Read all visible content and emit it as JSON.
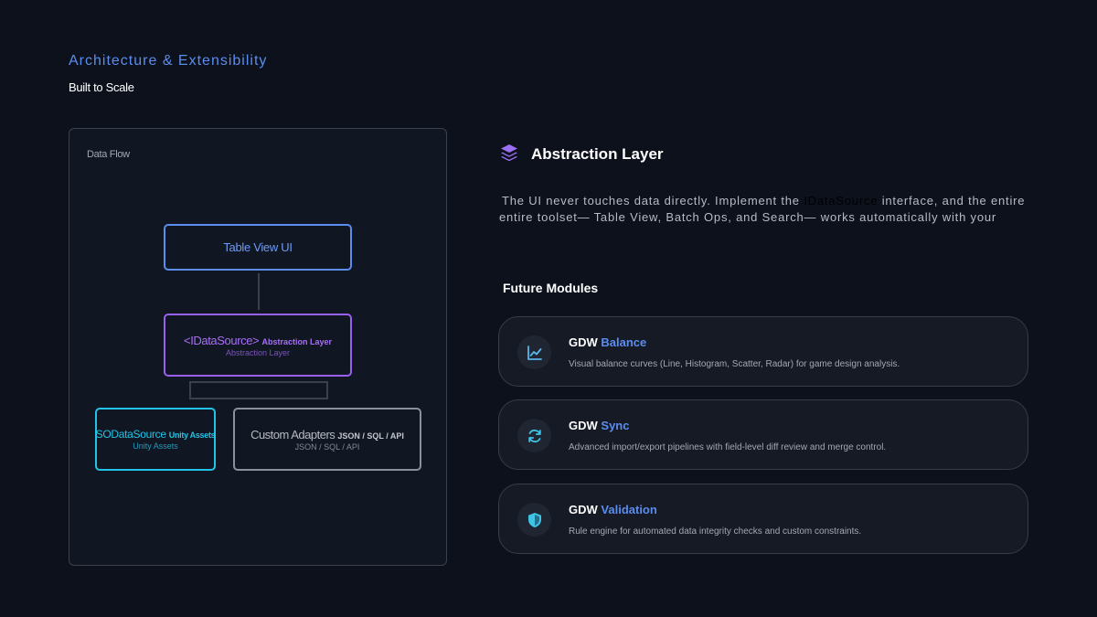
{
  "header": {
    "title": "Architecture & Extensibility",
    "subtitle": "Built to Scale"
  },
  "diagram": {
    "label": "Data Flow",
    "table_view": {
      "title": "Table View UI"
    },
    "abstraction": {
      "title": "<IDataSource>",
      "tag": "Abstraction Layer",
      "subtitle": "Abstraction Layer"
    },
    "so_source": {
      "title": "SODataSource",
      "tag": "Unity Assets",
      "subtitle": "Unity Assets"
    },
    "custom_adapters": {
      "title": "Custom Adapters",
      "tag": "JSON / SQL / API",
      "subtitle": "JSON / SQL / API"
    }
  },
  "abstraction_layer": {
    "title": "Abstraction Layer",
    "desc_before": "The UI never touches data directly. Implement the ",
    "desc_highlight": "IDataSource",
    "desc_after": " interface, and the entire",
    "desc_line2": "entire toolset— Table View, Batch Ops, and Search— works automatically with your"
  },
  "future": {
    "title": "Future Modules",
    "modules": [
      {
        "prefix": "GDW",
        "name": "Balance",
        "icon": "chart-line-icon",
        "desc": "Visual balance curves (Line, Histogram, Scatter, Radar) for game design analysis."
      },
      {
        "prefix": "GDW",
        "name": "Sync",
        "icon": "sync-icon",
        "desc": "Advanced import/export pipelines with field-level diff review and merge control."
      },
      {
        "prefix": "GDW",
        "name": "Validation",
        "icon": "shield-icon",
        "desc": "Rule engine for automated data integrity checks and custom constraints."
      }
    ]
  },
  "colors": {
    "background": "#0c111c",
    "accent_blue": "#5b8dee",
    "accent_purple": "#9b5ff0",
    "accent_cyan": "#22c3e6",
    "neutral_gray": "#8c909a"
  }
}
